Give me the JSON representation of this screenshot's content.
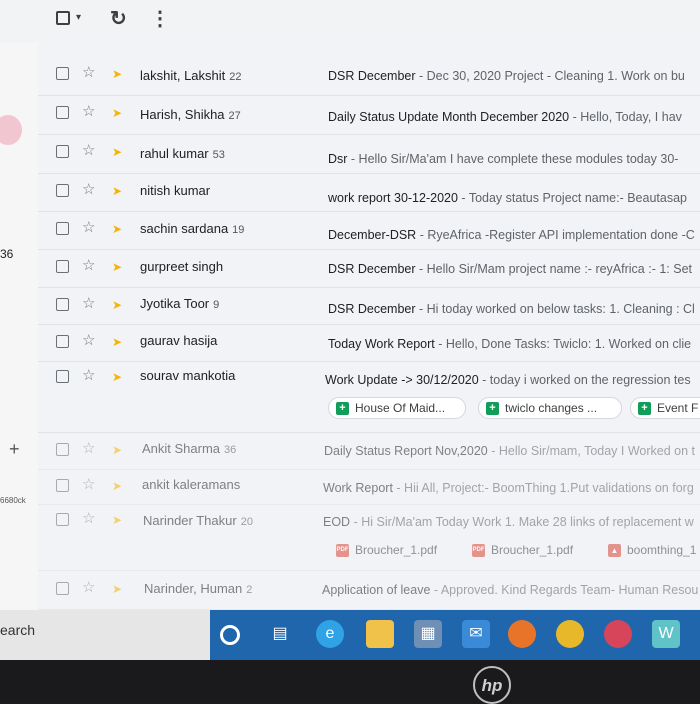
{
  "toolbar": {
    "select_caret": "▾",
    "refresh_icon": "↻",
    "more_icon": "⋮"
  },
  "leftbar": {
    "count": "36",
    "plus": "+",
    "code": "6680ck"
  },
  "icons": {
    "checkbox": "checkbox-icon",
    "star": "☆",
    "important": "important-marker-icon"
  },
  "emails": [
    {
      "sender": "lakshit, Lakshit",
      "count": "22",
      "subject": "DSR December",
      "snippet": " - Dec 30, 2020 Project - Cleaning 1. Work on bu"
    },
    {
      "sender": "Harish, Shikha",
      "count": "27",
      "subject": "Daily Status Update Month December 2020",
      "snippet": " - Hello, Today, I hav"
    },
    {
      "sender": "rahul kumar",
      "count": "53",
      "subject": "Dsr",
      "snippet": " - Hello Sir/Ma'am I have complete these modules today 30-"
    },
    {
      "sender": "nitish kumar",
      "count": "",
      "subject": "work report 30-12-2020",
      "snippet": " - Today status Project name:- Beautasap"
    },
    {
      "sender": "sachin sardana",
      "count": "19",
      "subject": "December-DSR",
      "snippet": " - RyeAfrica -Register API implementation done -C"
    },
    {
      "sender": "gurpreet singh",
      "count": "",
      "subject": "DSR December",
      "snippet": " - Hello Sir/Mam project name :- reyAfrica :- 1: Set"
    },
    {
      "sender": "Jyotika Toor",
      "count": "9",
      "subject": "DSR December",
      "snippet": " - Hi today worked on below tasks: 1. Cleaning : Cl"
    },
    {
      "sender": "gaurav hasija",
      "count": "",
      "subject": "Today Work Report",
      "snippet": " - Hello, Done Tasks: Twiclo: 1. Worked on clie"
    },
    {
      "sender": "sourav mankotia",
      "count": "",
      "subject": "Work Update -> 30/12/2020",
      "snippet": " - today i worked on the regression tes"
    },
    {
      "sender": "Ankit Sharma",
      "count": "36",
      "subject": "Daily Status Report Nov,2020",
      "snippet": " - Hello Sir/mam, Today I Worked on t"
    },
    {
      "sender": "ankit kaleramans",
      "count": "",
      "subject": "Work Report",
      "snippet": " - Hii All, Project:- BoomThing 1.Put validations on forg"
    },
    {
      "sender": "Narinder Thakur",
      "count": "20",
      "subject": "EOD",
      "snippet": " - Hi Sir/Ma'am Today Work 1. Make 28 links of replacement w"
    },
    {
      "sender": "Narinder, Human",
      "count": "2",
      "subject": "Application of leave",
      "snippet": " - Approved. Kind Regards Team- Human Resou"
    }
  ],
  "chips_row8": [
    {
      "label": "House Of Maid...",
      "icon": "+"
    },
    {
      "label": "twiclo changes ...",
      "icon": "+"
    },
    {
      "label": "Event F",
      "icon": "+"
    }
  ],
  "chips_row11": [
    {
      "label": "Broucher_1.pdf",
      "icon": "PDF"
    },
    {
      "label": "Broucher_1.pdf",
      "icon": "PDF"
    },
    {
      "label": "boomthing_1",
      "icon": "▲"
    }
  ],
  "taskbar": {
    "search_text": "earch",
    "icons": [
      "cortana-icon",
      "task-view-icon",
      "edge-icon",
      "file-explorer-icon",
      "store-icon",
      "mail-icon",
      "firefox-icon",
      "chrome-icon",
      "chat-icon",
      "app-icon"
    ]
  },
  "brand": {
    "logo": "hp"
  },
  "colors": {
    "important": "#f4b400",
    "sheet_icon": "#0f9d58",
    "pdf_icon": "#db4437",
    "taskbar": "#1f66ad"
  }
}
